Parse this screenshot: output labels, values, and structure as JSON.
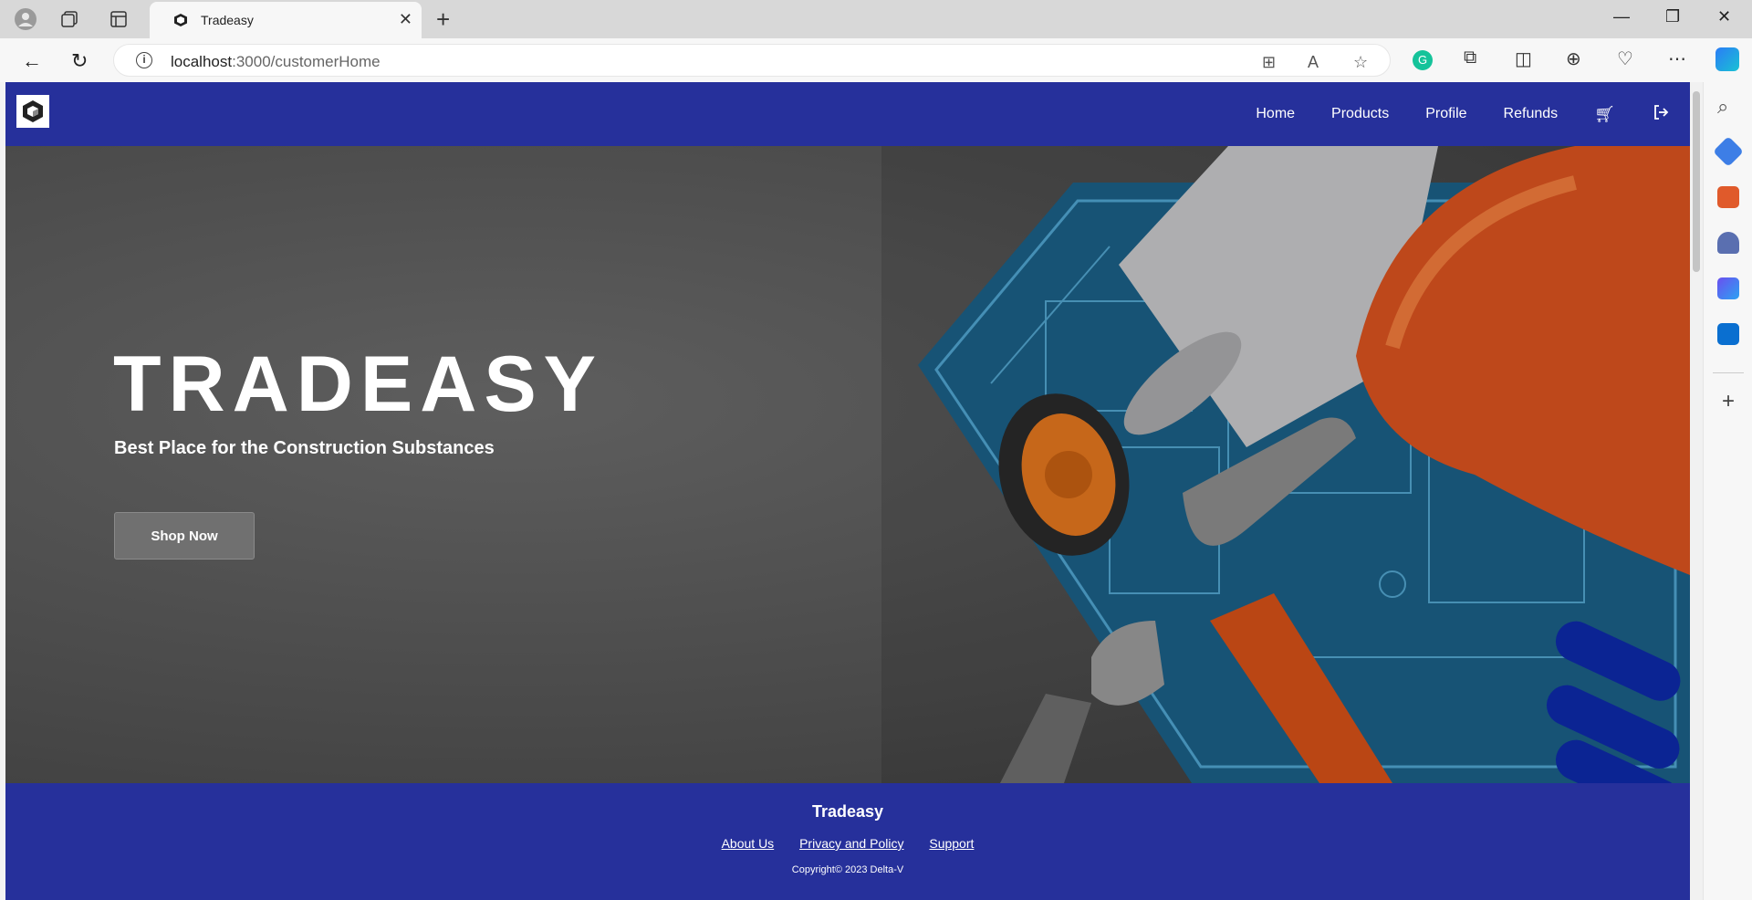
{
  "browser": {
    "tab_title": "Tradeasy",
    "url_host": "localhost",
    "url_path": ":3000/customerHome"
  },
  "nav": {
    "links": [
      "Home",
      "Products",
      "Profile",
      "Refunds"
    ]
  },
  "hero": {
    "title": "TRADEASY",
    "subtitle": "Best Place for the Construction Substances",
    "cta": "Shop Now"
  },
  "footer": {
    "title": "Tradeasy",
    "links": [
      "About Us",
      "Privacy and Policy",
      "Support"
    ],
    "copyright": "Copyright© 2023 Delta-V"
  },
  "colors": {
    "brand": "#26309b",
    "hero_overlay": "#4e4e4e"
  },
  "icons": [
    "cart-icon",
    "logout-icon",
    "logo-icon"
  ]
}
